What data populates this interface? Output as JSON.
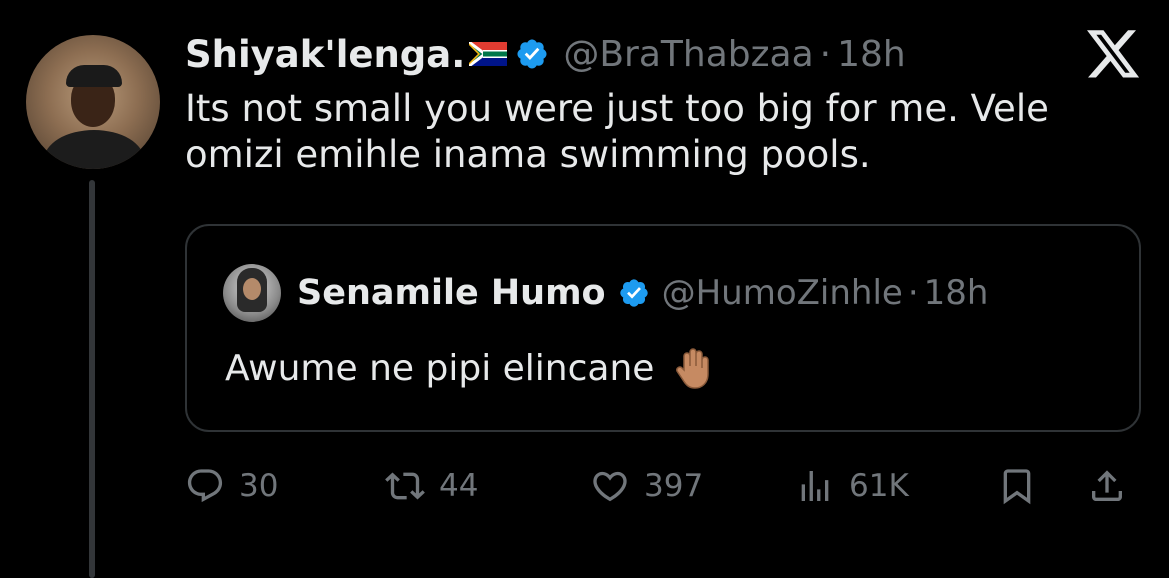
{
  "author": {
    "display_name": "Shiyak'lenga.",
    "flag_icon": "south-africa-flag-icon",
    "verified_icon": "verified-badge-icon",
    "handle": "@BraThabzaa",
    "separator": "·",
    "time": "18h"
  },
  "tweet": {
    "text": "Its not small you were just too big for me. Vele omizi emihle inama swimming pools."
  },
  "quoted_tweet": {
    "display_name": "Senamile Humo",
    "verified_icon": "verified-badge-icon",
    "handle": "@HumoZinhle",
    "separator": "·",
    "time": "18h",
    "text": "Awume ne pipi elincane",
    "emoji_icon": "raised-hand-icon"
  },
  "actions": {
    "replies": "30",
    "reposts": "44",
    "likes": "397",
    "views": "61K"
  },
  "colors": {
    "background": "#000000",
    "text_primary": "#e7e9ea",
    "text_secondary": "#71767b",
    "verified_blue": "#1d9bf0",
    "border": "#2f3336"
  }
}
